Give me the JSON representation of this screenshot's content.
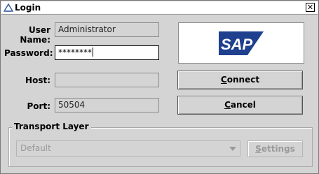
{
  "window": {
    "title": "Login",
    "close_glyph": "✕"
  },
  "form": {
    "username_label": "User Name:",
    "username_value": "Administrator",
    "password_label": "Password:",
    "password_value": "********",
    "host_label": "Host:",
    "host_value": "",
    "port_label": "Port:",
    "port_value": "50504"
  },
  "logo": {
    "text": "SAP",
    "color": "#1f3f8f"
  },
  "buttons": {
    "connect_mnemonic": "C",
    "connect_rest": "onnect",
    "cancel_mnemonic": "C",
    "cancel_rest": "ancel"
  },
  "transport": {
    "group_label": "Transport Layer",
    "selected": "Default",
    "settings_mnemonic": "S",
    "settings_rest": "ettings"
  }
}
